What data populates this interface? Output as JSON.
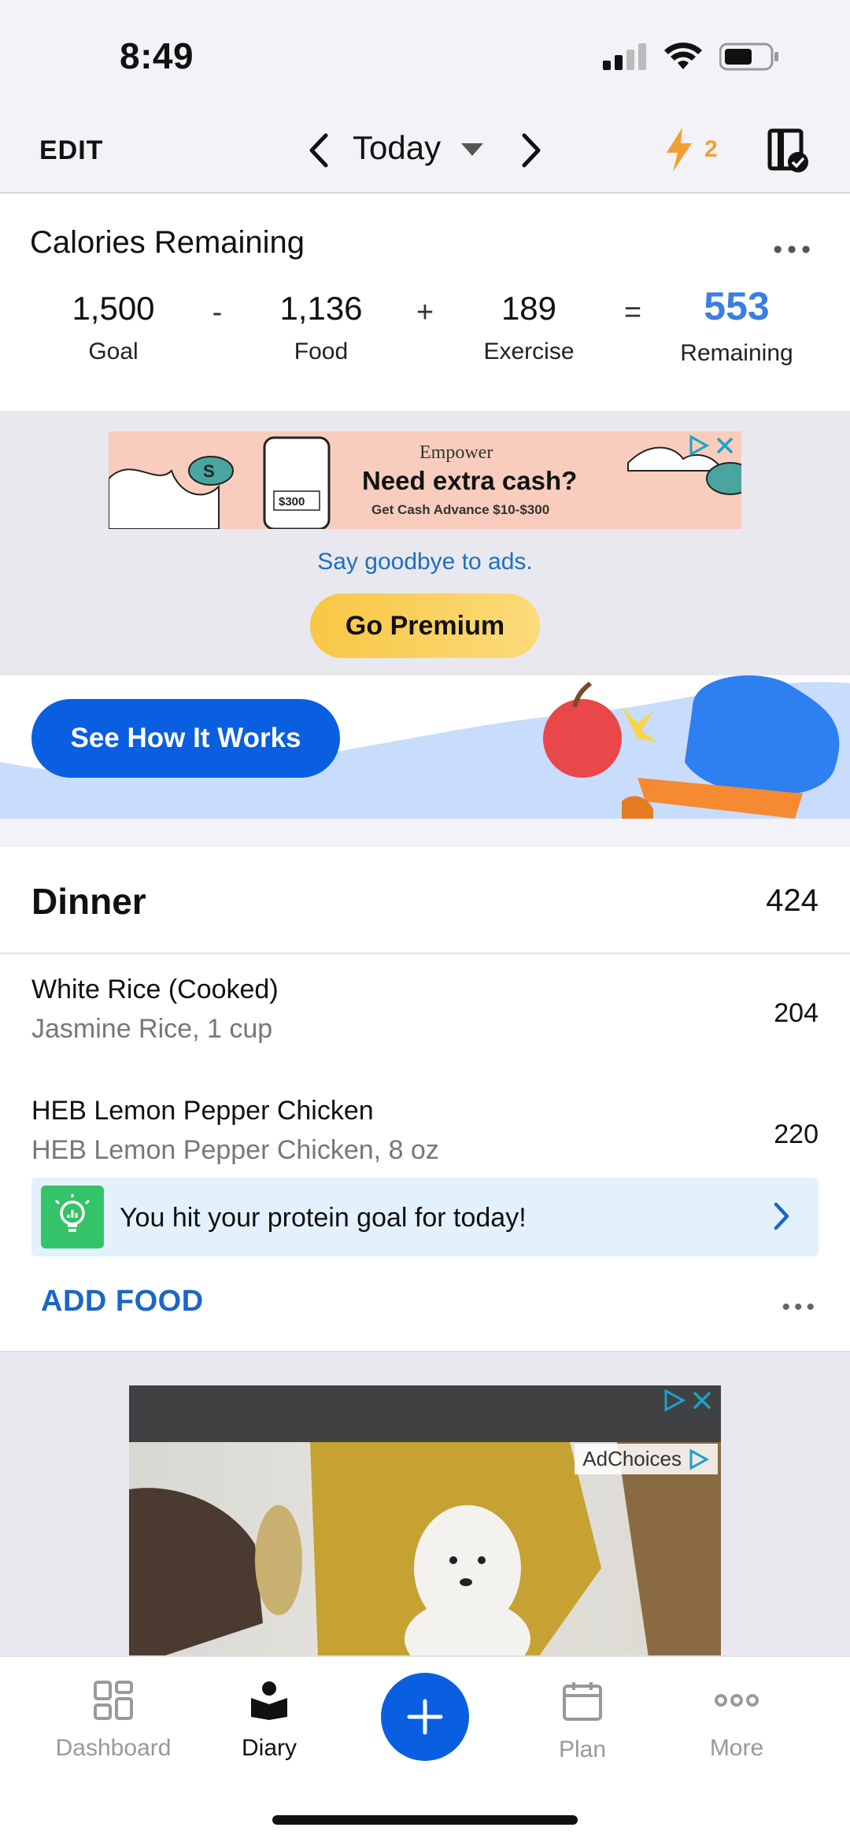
{
  "status_bar": {
    "time": "8:49"
  },
  "nav": {
    "edit_label": "EDIT",
    "date_label": "Today",
    "streak_count": "2"
  },
  "calories": {
    "title": "Calories Remaining",
    "goal": {
      "value": "1,500",
      "label": "Goal"
    },
    "food": {
      "value": "1,136",
      "label": "Food"
    },
    "exercise": {
      "value": "189",
      "label": "Exercise"
    },
    "remaining": {
      "value": "553",
      "label": "Remaining"
    },
    "op_minus": "-",
    "op_plus": "+",
    "op_equals": "="
  },
  "ad_banner": {
    "brand": "Empower",
    "headline": "Need extra cash?",
    "subline": "Get Cash Advance $10-$300",
    "amount": "$300"
  },
  "premium": {
    "goodbye_text": "Say goodbye to ads.",
    "button_label": "Go Premium"
  },
  "promo": {
    "button_label": "See How It Works"
  },
  "dinner": {
    "title": "Dinner",
    "total": "424",
    "items": [
      {
        "name": "White Rice (Cooked)",
        "detail": "Jasmine  Rice, 1 cup",
        "calories": "204"
      },
      {
        "name": "HEB Lemon Pepper Chicken",
        "detail": "HEB Lemon Pepper Chicken, 8 oz",
        "calories": "220"
      }
    ],
    "insight": "You hit your protein goal for today!",
    "add_food_label": "ADD FOOD"
  },
  "ad2": {
    "adchoices_label": "AdChoices"
  },
  "tabs": [
    {
      "label": "Dashboard",
      "icon": "dashboard-icon"
    },
    {
      "label": "Diary",
      "icon": "diary-icon",
      "active": true
    },
    {
      "label": "Plan",
      "icon": "calendar-icon"
    },
    {
      "label": "More",
      "icon": "more-icon"
    }
  ],
  "colors": {
    "accent": "#0a5fe0",
    "remaining": "#3a7ee0",
    "premium": "#f8c744",
    "streak": "#f0a030",
    "insight_bg": "#e3f1fc"
  }
}
